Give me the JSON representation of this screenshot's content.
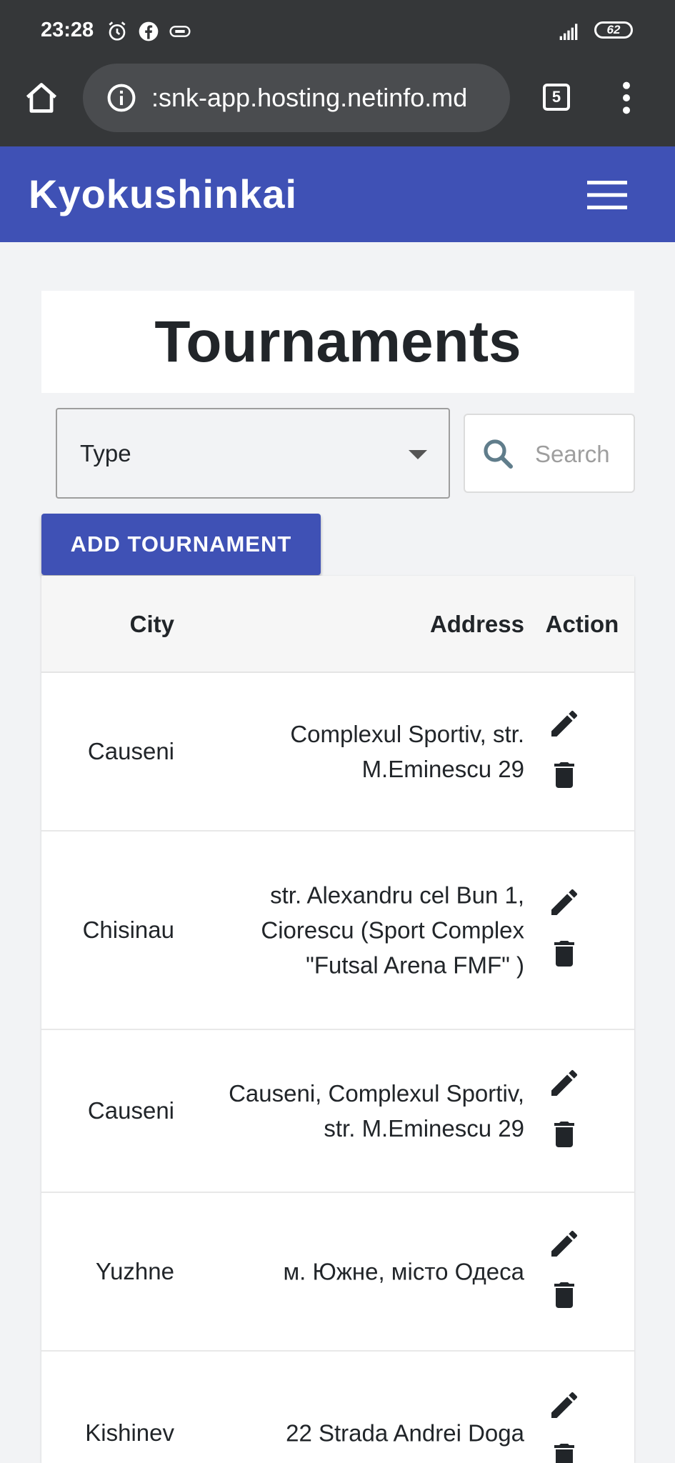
{
  "status_bar": {
    "time": "23:28",
    "icons": [
      "alarm-icon",
      "facebook-icon",
      "vpn-icon",
      "signal-icon",
      "battery-icon"
    ],
    "battery_level": "62"
  },
  "browser": {
    "url": ":snk-app.hosting.netinfo.md",
    "tab_count": "5",
    "icons": [
      "home-icon",
      "info-icon",
      "tabs-icon",
      "more-vert-icon"
    ]
  },
  "app_bar": {
    "brand": "Kyokushinkai",
    "color": "#3f51b5",
    "menu_icon": "hamburger-menu-icon"
  },
  "page": {
    "title": "Tournaments"
  },
  "filters": {
    "type_label": "Type",
    "search_placeholder": "Search"
  },
  "actions": {
    "add_label": "ADD TOURNAMENT"
  },
  "table": {
    "headers": {
      "city": "City",
      "address": "Address",
      "action": "Action"
    },
    "rows": [
      {
        "city": "Causeni",
        "address": "Complexul Sportiv, str. M.Eminescu 29"
      },
      {
        "city": "Chisinau",
        "address": "str. Alexandru cel Bun 1, Ciorescu (Sport Complex \"Futsal Arena FMF\" )"
      },
      {
        "city": "Causeni",
        "address": "Causeni, Complexul Sportiv, str. M.Eminescu 29"
      },
      {
        "city": "Yuzhne",
        "address": "м. Южне, місто Одеса"
      },
      {
        "city": "Kishinev",
        "address": "22 Strada Andrei Doga"
      }
    ],
    "row_icons": [
      "edit-icon",
      "delete-icon"
    ]
  }
}
